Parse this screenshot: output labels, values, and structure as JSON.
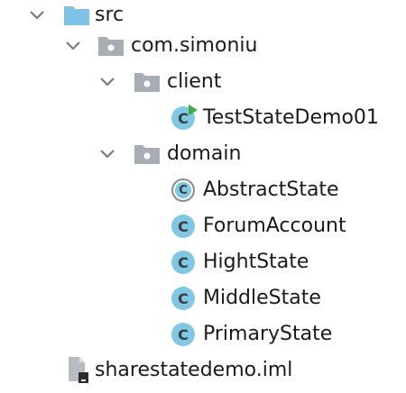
{
  "tree": {
    "src": {
      "label": "src",
      "icon": "folder-icon"
    },
    "package_root": {
      "label": "com.simoniu",
      "icon": "package-icon"
    },
    "package_client": {
      "label": "client",
      "icon": "package-icon"
    },
    "client_classes": [
      {
        "label": "TestStateDemo01",
        "icon": "runnable-class-icon"
      }
    ],
    "package_domain": {
      "label": "domain",
      "icon": "package-icon"
    },
    "domain_classes": [
      {
        "label": "AbstractState",
        "icon": "abstract-class-icon"
      },
      {
        "label": "ForumAccount",
        "icon": "class-icon"
      },
      {
        "label": "HightState",
        "icon": "class-icon"
      },
      {
        "label": "MiddleState",
        "icon": "class-icon"
      },
      {
        "label": "PrimaryState",
        "icon": "class-icon"
      }
    ],
    "module_file": {
      "label": "sharestatedemo.iml",
      "icon": "module-file-icon"
    },
    "class_glyph": "C"
  },
  "colors": {
    "src_folder": "#7fc2e8",
    "package_folder": "#a8adb4",
    "class_icon": "#7ec8e3",
    "run_marker": "#3ea84a",
    "chevron": "#7a7a7a"
  }
}
